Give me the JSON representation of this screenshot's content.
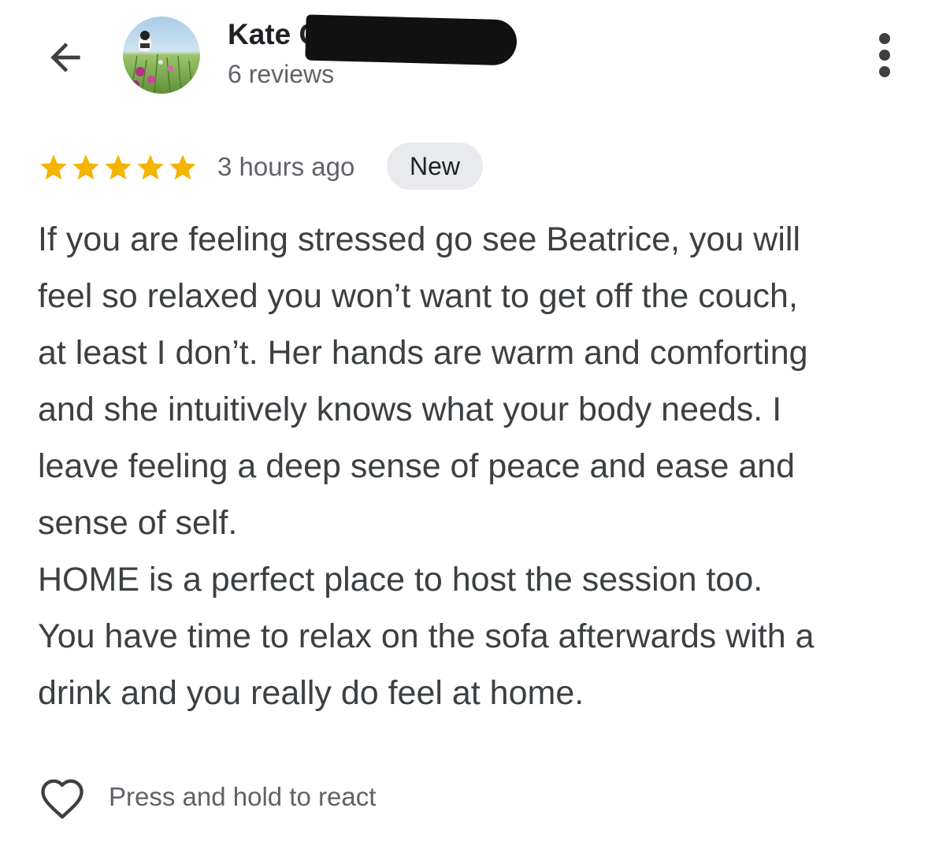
{
  "header": {
    "back_icon": "arrow-left-icon",
    "reviewer_name": "Kate Gunawarra",
    "review_count": "6 reviews",
    "more_icon": "more-vert-icon"
  },
  "review": {
    "rating": 5,
    "rating_max": 5,
    "star_color": "#f4b400",
    "timestamp": "3 hours ago",
    "badge": "New",
    "paragraph_lines": [
      "If you are feeling stressed go see Beatrice, you will",
      "feel so relaxed you won’t want to get off the couch,",
      "at least I don’t. Her hands are warm and comforting",
      "and she intuitively knows what your body needs. I",
      "leave feeling a deep sense of peace and ease and",
      "sense of self.",
      "HOME is a perfect place to host the session too.",
      "You have time to relax on the sofa afterwards with a",
      "drink and you really do feel at home."
    ]
  },
  "reaction": {
    "icon": "heart-outline-icon",
    "label": "Press and hold to react"
  }
}
